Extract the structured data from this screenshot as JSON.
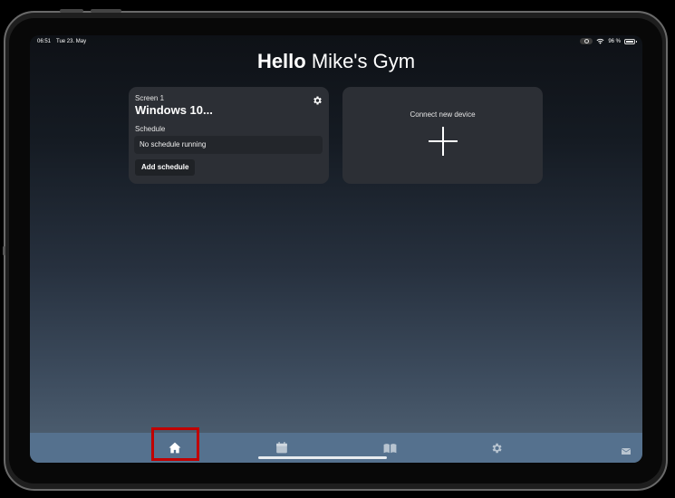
{
  "status_bar": {
    "time": "06:51",
    "date": "Tue 23. May",
    "battery": "96 %"
  },
  "greeting": {
    "bold": "Hello",
    "name": "Mike's Gym"
  },
  "screen_card": {
    "label": "Screen 1",
    "name": "Windows 10...",
    "schedule_label": "Schedule",
    "schedule_status": "No schedule running",
    "add_schedule_label": "Add schedule",
    "settings_icon": "gear-icon"
  },
  "device_card": {
    "label": "Connect new device",
    "icon": "plus-icon"
  },
  "tab_bar": {
    "tabs": [
      {
        "name": "home",
        "icon": "home-icon",
        "active": true
      },
      {
        "name": "calendar",
        "icon": "calendar-icon",
        "active": false
      },
      {
        "name": "library",
        "icon": "book-icon",
        "active": false
      },
      {
        "name": "settings",
        "icon": "gear-icon",
        "active": false
      }
    ],
    "extra_icon": "mail-icon"
  },
  "colors": {
    "tab_bar": "#55718e",
    "card": "#2c2f35",
    "highlight": "#c00000"
  }
}
